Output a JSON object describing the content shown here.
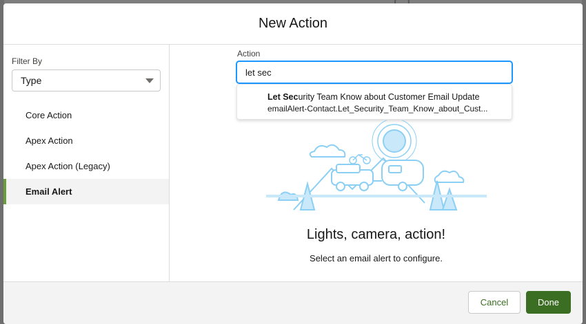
{
  "modal": {
    "title": "New Action"
  },
  "sidebar": {
    "filter_label": "Filter By",
    "filter_value": "Type",
    "items": [
      {
        "label": "Core Action",
        "active": false
      },
      {
        "label": "Apex Action",
        "active": false
      },
      {
        "label": "Apex Action (Legacy)",
        "active": false
      },
      {
        "label": "Email Alert",
        "active": true
      }
    ]
  },
  "action": {
    "label": "Action",
    "value": "let sec",
    "suggestion": {
      "title_bold": "Let Sec",
      "title_rest": "urity Team Know about Customer Email Update",
      "subtitle": "emailAlert-Contact.Let_Security_Team_Know_about_Cust..."
    }
  },
  "empty_state": {
    "title": "Lights, camera, action!",
    "subtitle": "Select an email alert to configure.",
    "illustration_icon": "camping-scene-illustration"
  },
  "footer": {
    "cancel_label": "Cancel",
    "done_label": "Done"
  },
  "colors": {
    "accent_green": "#3b6e22",
    "focus_blue": "#1b96ff",
    "illustration_blue": "#8ccff5"
  }
}
